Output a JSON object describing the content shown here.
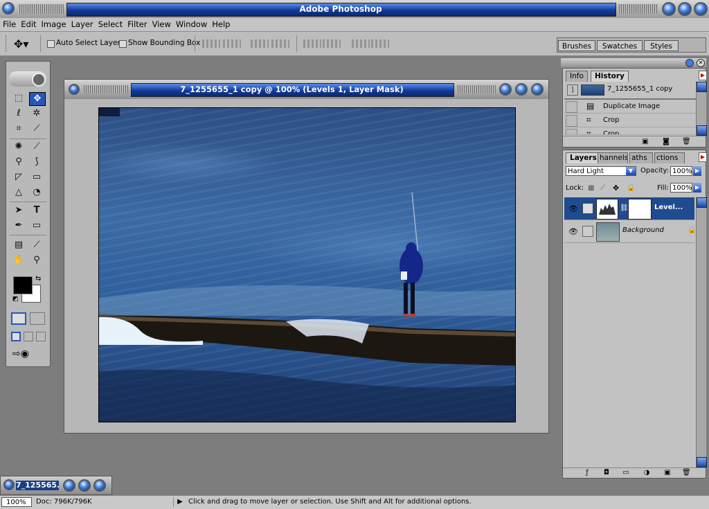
{
  "app": {
    "title": "Adobe Photoshop"
  },
  "menu": [
    "File",
    "Edit",
    "Image",
    "Layer",
    "Select",
    "Filter",
    "View",
    "Window",
    "Help"
  ],
  "options": {
    "auto_select": "Auto Select Layer",
    "show_bounding": "Show Bounding Box",
    "tabs": [
      "Brushes",
      "Swatches",
      "Styles"
    ]
  },
  "document": {
    "title": "7_1255655_1 copy @ 100% (Levels 1, Layer Mask)",
    "minimized_title": "7_125565..."
  },
  "history": {
    "tabs": [
      "Info",
      "History"
    ],
    "snapshot": "7_1255655_1 copy",
    "rows": [
      "Duplicate Image",
      "Crop",
      "Crop"
    ]
  },
  "layers": {
    "tabs": [
      "Layers",
      "Channels",
      "Paths",
      "Actions"
    ],
    "tab_visible": [
      "Layers",
      "hannels",
      "aths",
      "ctions"
    ],
    "blend_mode": "Hard Light",
    "opacity_label": "Opacity:",
    "opacity": "100%",
    "lock_label": "Lock:",
    "fill_label": "Fill:",
    "fill": "100%",
    "items": [
      {
        "name": "Level...",
        "selected": true
      },
      {
        "name": "Background",
        "selected": false
      }
    ]
  },
  "status": {
    "zoom": "100%",
    "doc": "Doc: 796K/796K",
    "hint": "Click and drag to move layer or selection.  Use Shift and Alt for additional options."
  }
}
